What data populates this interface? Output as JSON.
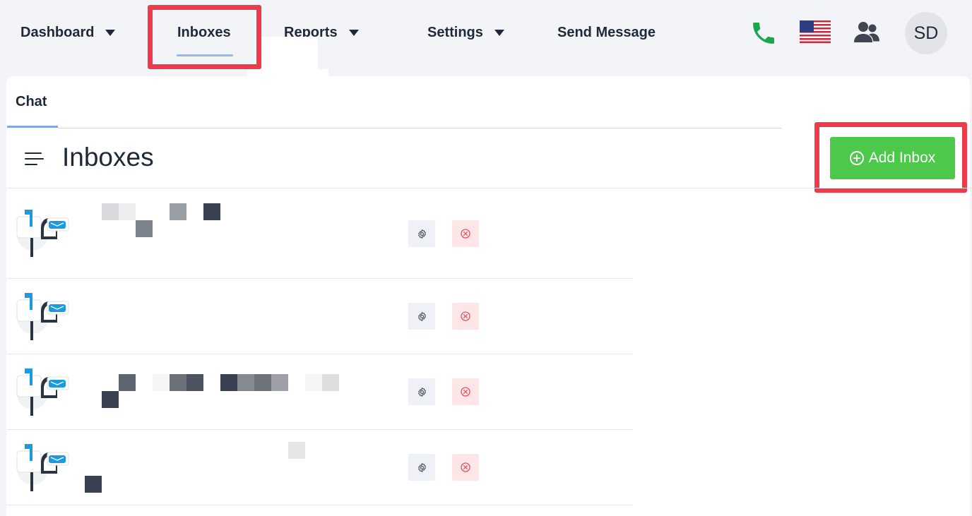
{
  "nav": {
    "dashboard": "Dashboard",
    "inboxes": "Inboxes",
    "reports": "Reports",
    "settings": "Settings",
    "send_message": "Send Message"
  },
  "header_icons": {
    "phone": "phone-icon",
    "flag": "us-flag-icon",
    "users": "users-icon",
    "avatar_initials": "SD"
  },
  "tabs": {
    "chat": "Chat"
  },
  "page": {
    "title": "Inboxes",
    "add_button": "Add Inbox"
  },
  "inboxes": [
    {
      "name": "",
      "icon": "mailbox-icon",
      "actions": [
        "gear-icon",
        "close-circle-icon"
      ]
    },
    {
      "name": "",
      "icon": "mailbox-icon",
      "actions": [
        "gear-icon",
        "close-circle-icon"
      ]
    },
    {
      "name": "",
      "icon": "mailbox-icon",
      "actions": [
        "gear-icon",
        "close-circle-icon"
      ]
    },
    {
      "name": "",
      "icon": "mailbox-icon",
      "actions": [
        "gear-icon",
        "close-circle-icon"
      ]
    }
  ],
  "colors": {
    "accent_green": "#4cc84a",
    "highlight_red": "#ee3a4a",
    "tab_underline": "#7fa7e6",
    "phone_green": "#1aa64a"
  }
}
